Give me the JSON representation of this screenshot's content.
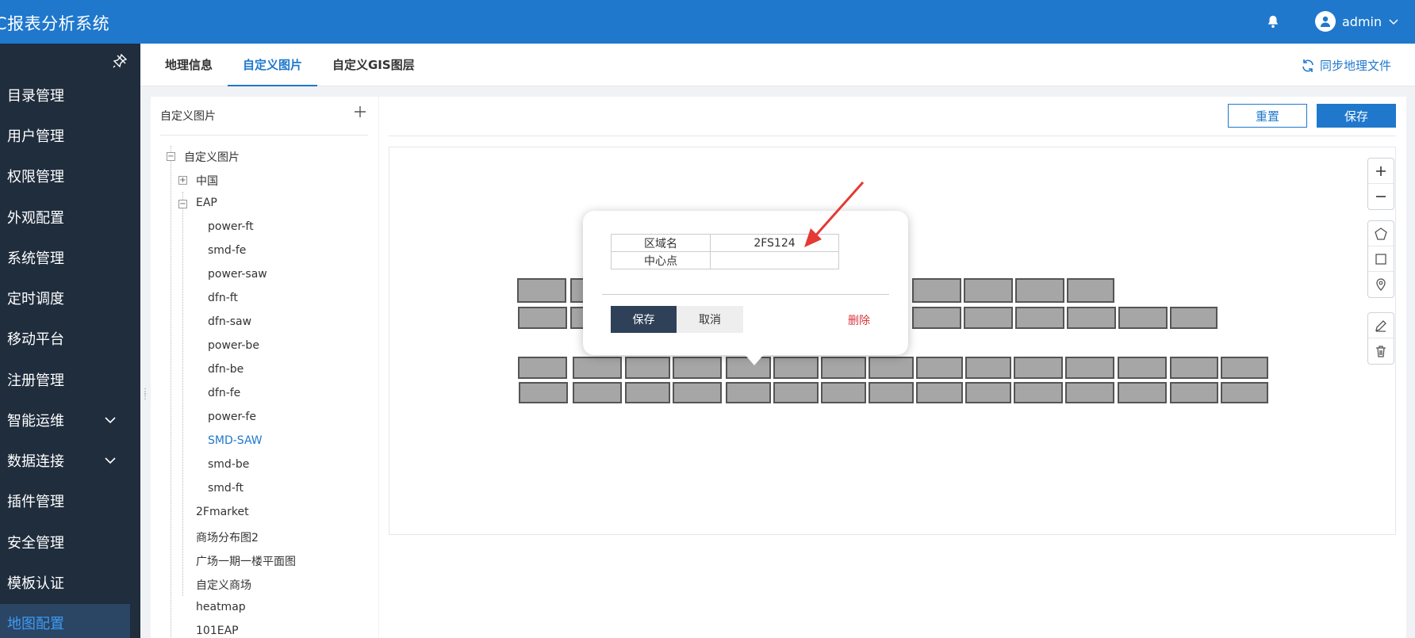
{
  "header": {
    "title": "C报表分析系统",
    "user": "admin"
  },
  "sidebar": {
    "items": [
      {
        "label": "目录管理"
      },
      {
        "label": "用户管理"
      },
      {
        "label": "权限管理"
      },
      {
        "label": "外观配置"
      },
      {
        "label": "系统管理"
      },
      {
        "label": "定时调度"
      },
      {
        "label": "移动平台"
      },
      {
        "label": "注册管理"
      },
      {
        "label": "智能运维"
      },
      {
        "label": "数据连接"
      },
      {
        "label": "插件管理"
      },
      {
        "label": "安全管理"
      },
      {
        "label": "模板认证"
      },
      {
        "label": "地图配置"
      }
    ],
    "active_index": 13
  },
  "tabs": [
    {
      "label": "地理信息"
    },
    {
      "label": "自定义图片"
    },
    {
      "label": "自定义GIS图层"
    }
  ],
  "sync_label": "同步地理文件",
  "tree": {
    "header": "自定义图片",
    "root": "自定义图片",
    "nodes": {
      "china": "中国",
      "eap": "EAP",
      "eap_children": [
        "power-ft",
        "smd-fe",
        "power-saw",
        "dfn-ft",
        "dfn-saw",
        "power-be",
        "dfn-be",
        "dfn-fe",
        "power-fe",
        "SMD-SAW",
        "smd-be",
        "smd-ft"
      ],
      "others": [
        "2Fmarket",
        "商场分布图2",
        "广场一期一楼平面图",
        "自定义商场",
        "heatmap",
        "101EAP"
      ]
    },
    "selected": "SMD-SAW"
  },
  "toolbar": {
    "reset_label": "重置",
    "save_label": "保存"
  },
  "popup": {
    "region_key": "区域名",
    "region_value": "2FS124",
    "center_key": "中心点",
    "center_value": "",
    "save_label": "保存",
    "cancel_label": "取消",
    "delete_label": "删除"
  },
  "colors": {
    "brand": "#1f78cc",
    "sidebar_bg": "#1f2d3d",
    "delete": "#d9363e",
    "cell_fill": "#a6a6a6"
  }
}
